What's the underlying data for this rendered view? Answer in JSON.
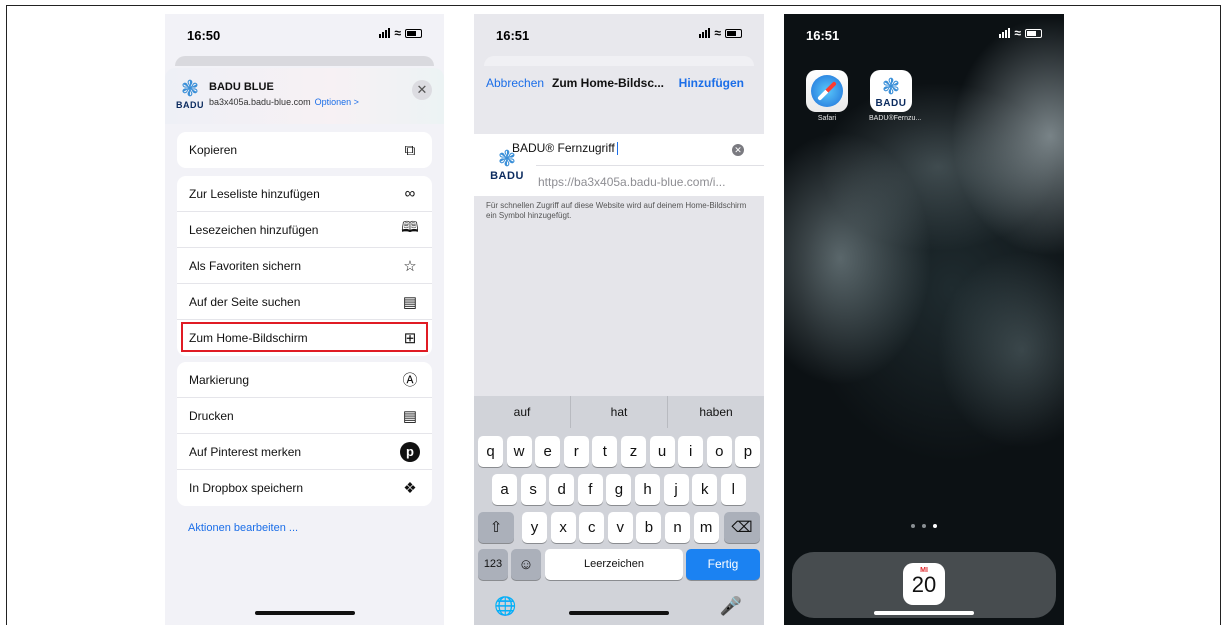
{
  "panel1": {
    "time": "16:50",
    "share": {
      "title": "BADU BLUE",
      "url": "ba3x405a.badu-blue.com",
      "options": "Optionen >",
      "logo_text": "BADU",
      "close": "✕"
    },
    "group1": [
      {
        "label": "Kopieren",
        "icon": "copy-icon"
      }
    ],
    "group2": [
      {
        "label": "Zur Leseliste hinzufügen",
        "icon": "glasses-icon"
      },
      {
        "label": "Lesezeichen hinzufügen",
        "icon": "book-icon"
      },
      {
        "label": "Als Favoriten sichern",
        "icon": "star-icon"
      },
      {
        "label": "Auf der Seite suchen",
        "icon": "find-in-page-icon"
      },
      {
        "label": "Zum Home-Bildschirm",
        "icon": "add-square-icon",
        "highlighted": true
      }
    ],
    "group3": [
      {
        "label": "Markierung",
        "icon": "markup-icon"
      },
      {
        "label": "Drucken",
        "icon": "printer-icon"
      },
      {
        "label": "Auf Pinterest merken",
        "icon": "pinterest-icon"
      },
      {
        "label": "In Dropbox speichern",
        "icon": "dropbox-icon"
      }
    ],
    "edit_actions": "Aktionen bearbeiten ..."
  },
  "panel2": {
    "time": "16:51",
    "nav": {
      "cancel": "Abbrechen",
      "title": "Zum Home-Bildsc...",
      "add": "Hinzufügen"
    },
    "name_value": "BADU® Fernzugriff",
    "url": "https://ba3x405a.badu-blue.com/i...",
    "logo_text": "BADU",
    "hint": "Für schnellen Zugriff auf diese Website wird auf deinem Home-Bildschirm ein Symbol hinzugefügt.",
    "suggestions": [
      "auf",
      "hat",
      "haben"
    ],
    "keyboard": {
      "row1": [
        "q",
        "w",
        "e",
        "r",
        "t",
        "z",
        "u",
        "i",
        "o",
        "p"
      ],
      "row2": [
        "a",
        "s",
        "d",
        "f",
        "g",
        "h",
        "j",
        "k",
        "l"
      ],
      "row3": [
        "y",
        "x",
        "c",
        "v",
        "b",
        "n",
        "m"
      ],
      "numbers": "123",
      "space": "Leerzeichen",
      "done": "Fertig"
    }
  },
  "panel3": {
    "time": "16:51",
    "apps": [
      {
        "label": "Safari",
        "icon": "safari-icon"
      },
      {
        "label": "BADU®Fernzu...",
        "icon": "badu-app-icon",
        "logo_text": "BADU"
      }
    ],
    "dock_calendar": {
      "weekday": "MI",
      "day": "20"
    }
  },
  "colors": {
    "accent": "#1b6ee8",
    "highlight_border": "#e01b24",
    "done_key": "#1b82f2"
  }
}
